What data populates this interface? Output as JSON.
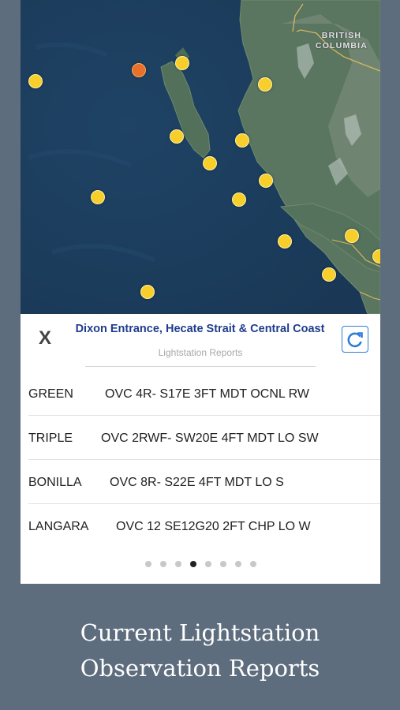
{
  "map": {
    "region_label": "BRITISH COLUMBIA",
    "land_color": "#55705a",
    "water_color": "#1d3f5f"
  },
  "panel": {
    "close_label": "X",
    "title": "Dixon Entrance, Hecate Strait & Central Coast",
    "subtitle": "Lightstation Reports",
    "refresh_icon": "refresh-icon"
  },
  "reports": [
    {
      "station": "GREEN",
      "observation": "OVC 4R- S17E 3FT MDT OCNL RW"
    },
    {
      "station": "TRIPLE",
      "observation": "OVC 2RWF- SW20E 4FT MDT LO SW"
    },
    {
      "station": "BONILLA",
      "observation": "OVC 8R- S22E 4FT MDT LO S"
    },
    {
      "station": "LANGARA",
      "observation": "OVC 12 SE12G20 2FT CHP LO W"
    }
  ],
  "pagination": {
    "pages": 8,
    "current": 4
  },
  "caption": {
    "line1": "Current Lightstation",
    "line2": "Observation Reports"
  }
}
